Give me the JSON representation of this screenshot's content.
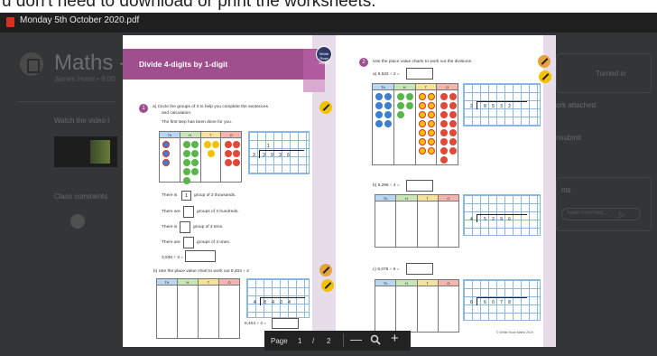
{
  "caption_top": "u don't need to download or print the worksheets.",
  "file": {
    "name": "Monday 5th October 2020.pdf"
  },
  "background": {
    "class_title": "Maths -",
    "subtitle": "James Hood • 9:00",
    "watch_label": "Watch the video l",
    "comments_label": "Class comments",
    "turned_in": "Turned in",
    "attached": "ork attached",
    "unsubmit": "nsubmit",
    "private_label": "nts",
    "comment_placeholder": "ivate comment..."
  },
  "worksheet": {
    "banner_title": "Divide 4-digits by 1-digit",
    "logo_text": "White Rose Maths",
    "q1": {
      "number": "1",
      "a_text_1": "a)  Circle the groups of 3 to help you complete the sentences",
      "a_text_2": "and calculation.",
      "first_step": "The first step has been done for you.",
      "headers": [
        "Th",
        "H",
        "T",
        "O"
      ],
      "divisor": "3",
      "dividend_digits": [
        "3",
        "9",
        "3",
        "6"
      ],
      "quotient_digit": "1",
      "s1_a": "There is",
      "s1_val": "1",
      "s1_b": "group of 3 thousands.",
      "s2_a": "There are",
      "s2_b": "groups of 3 hundreds.",
      "s3_a": "There is",
      "s3_b": "group of 3 tens.",
      "s4_a": "There are",
      "s4_b": "groups of 3 ones.",
      "calc": "3,936 ÷ 3 =",
      "b_text": "b)  Use the place value chart to work out 8,404 ÷ 4",
      "b_divisor": "4",
      "b_digits": [
        "8",
        "4",
        "0",
        "4"
      ],
      "b_calc": "8,404 ÷ 4 ="
    },
    "q2": {
      "number": "2",
      "instruction": "Use the place value charts to work out the divisions.",
      "a_label": "a)  8,532 ÷ 2 =",
      "a_divisor": "2",
      "a_digits": [
        "8",
        "5",
        "3",
        "2"
      ],
      "b_label": "b)  5,296 ÷ 4 =",
      "b_divisor": "4",
      "b_digits": [
        "5",
        "2",
        "9",
        "6"
      ],
      "c_label": "c)  6,078 ÷ 6 =",
      "c_divisor": "6",
      "c_digits": [
        "6",
        "0",
        "7",
        "8"
      ],
      "footer": "© White Rose Maths 2019"
    }
  },
  "toolbar": {
    "page_label": "Page",
    "current": "1",
    "separator": "/",
    "total": "2",
    "minus": "—",
    "plus": "+"
  },
  "colors": {
    "banner": "#a04f8e",
    "lavender": "#e7ddea",
    "counter_blue": "#3d7fd0",
    "counter_green": "#5ab54b",
    "counter_yellow": "#f2c200",
    "counter_red": "#e0483a"
  }
}
